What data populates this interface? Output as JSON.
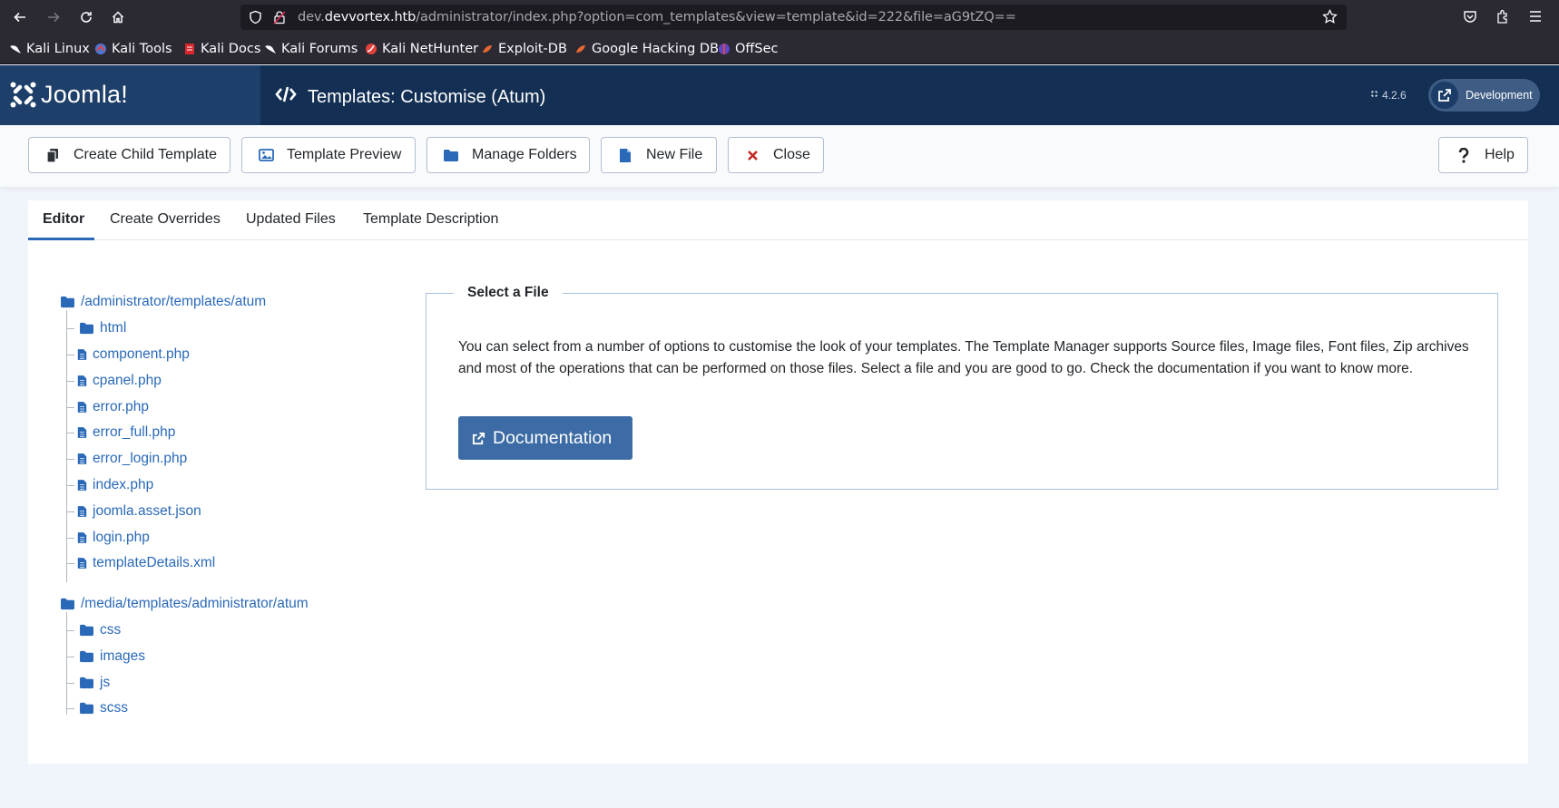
{
  "browser": {
    "url_prefix": "dev.",
    "url_host": "devvortex.htb",
    "url_path": "/administrator/index.php?option=com_templates&view=template&id=222&file=aG9tZQ==",
    "bookmarks": [
      "Kali Linux",
      "Kali Tools",
      "Kali Docs",
      "Kali Forums",
      "Kali NetHunter",
      "Exploit-DB",
      "Google Hacking DB",
      "OffSec"
    ]
  },
  "header": {
    "logo_text": "Joomla!",
    "title": "Templates: Customise (Atum)",
    "version": "4.2.6",
    "dev_label": "Development"
  },
  "toolbar": {
    "create_child": "Create Child Template",
    "preview": "Template Preview",
    "manage_folders": "Manage Folders",
    "new_file": "New File",
    "close": "Close",
    "help": "Help"
  },
  "tabs": [
    "Editor",
    "Create Overrides",
    "Updated Files",
    "Template Description"
  ],
  "tree": {
    "root1": "/administrator/templates/atum",
    "root1_children": [
      {
        "type": "folder",
        "name": "html"
      },
      {
        "type": "file",
        "name": "component.php"
      },
      {
        "type": "file",
        "name": "cpanel.php"
      },
      {
        "type": "file",
        "name": "error.php"
      },
      {
        "type": "file",
        "name": "error_full.php"
      },
      {
        "type": "file",
        "name": "error_login.php"
      },
      {
        "type": "file",
        "name": "index.php"
      },
      {
        "type": "file",
        "name": "joomla.asset.json"
      },
      {
        "type": "file",
        "name": "login.php"
      },
      {
        "type": "file",
        "name": "templateDetails.xml"
      }
    ],
    "root2": "/media/templates/administrator/atum",
    "root2_children": [
      {
        "type": "folder",
        "name": "css"
      },
      {
        "type": "folder",
        "name": "images"
      },
      {
        "type": "folder",
        "name": "js"
      },
      {
        "type": "folder",
        "name": "scss"
      }
    ]
  },
  "select_file": {
    "legend": "Select a File",
    "description": "You can select from a number of options to customise the look of your templates. The Template Manager supports Source files, Image files, Font files, Zip archives and most of the operations that can be performed on those files. Select a file and you are good to go. Check the documentation if you want to know more.",
    "button": "Documentation"
  },
  "colors": {
    "link": "#2a69b8",
    "header_bg": "#132f53",
    "doc_button": "#3c6ba5",
    "close_icon": "#c52827"
  }
}
